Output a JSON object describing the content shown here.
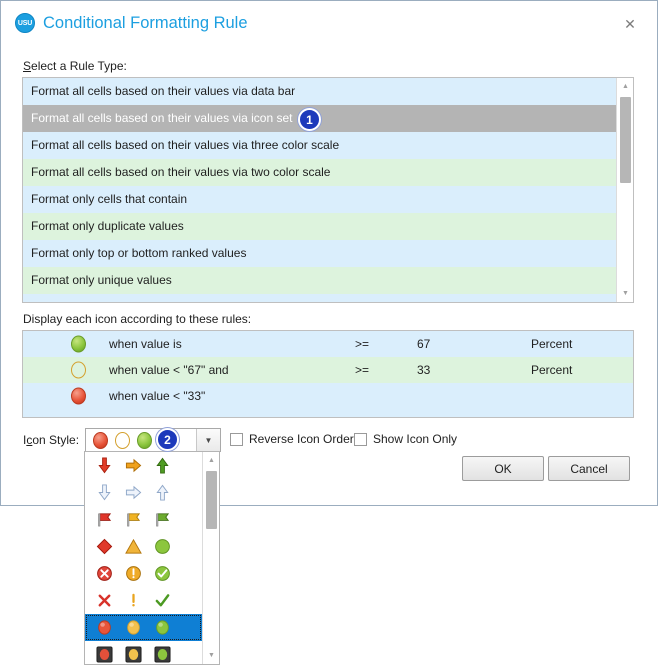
{
  "window": {
    "title": "Conditional Formatting Rule",
    "logo_text": "USU",
    "close_label": "✕"
  },
  "rule_type": {
    "label_prefix": "S",
    "label_rest": "elect a Rule Type:",
    "items": [
      {
        "text": "Format all cells based on their values via data bar",
        "selected": false
      },
      {
        "text": "Format all cells based on their values via icon set",
        "selected": true
      },
      {
        "text": "Format all cells based on their values via three color scale",
        "selected": false
      },
      {
        "text": "Format all cells based on their values via two color scale",
        "selected": false
      },
      {
        "text": "Format only cells that contain",
        "selected": false
      },
      {
        "text": "Format only duplicate values",
        "selected": false
      },
      {
        "text": "Format only top or bottom ranked values",
        "selected": false
      },
      {
        "text": "Format only unique values",
        "selected": false
      }
    ]
  },
  "icon_rules": {
    "label": "Display each icon according to these rules:",
    "rows": [
      {
        "icon": "green-ball-icon",
        "condition": "when value is",
        "operator": ">=",
        "value": "67",
        "value_type": "Percent"
      },
      {
        "icon": "yellow-ball-icon",
        "condition": "when value < \"67\" and",
        "operator": ">=",
        "value": "33",
        "value_type": "Percent"
      },
      {
        "icon": "red-ball-icon",
        "condition": "when value < \"33\"",
        "operator": "",
        "value": "",
        "value_type": ""
      }
    ]
  },
  "icon_style": {
    "label_prefix": "I",
    "label_mn": "c",
    "label_rest": "on Style:",
    "selected_set": "3-traffic-lights-unrimmed",
    "dropdown_arrow": "▼"
  },
  "options": {
    "reverse": {
      "pre": "Reverse Icon Or",
      "mn": "d",
      "post": "er",
      "checked": false
    },
    "show_icon_only": {
      "pre": "Show ",
      "mn": "I",
      "post": "con Only",
      "checked": false
    }
  },
  "buttons": {
    "ok": "OK",
    "cancel": "Cancel"
  },
  "icon_set_options": [
    {
      "name": "3-arrows-colored",
      "icons": [
        "red-down-arrow-icon",
        "orange-right-arrow-icon",
        "green-up-arrow-icon"
      ],
      "selected": false
    },
    {
      "name": "3-arrows-gray",
      "icons": [
        "gray-down-arrow-icon",
        "gray-right-arrow-icon",
        "gray-up-arrow-icon"
      ],
      "selected": false
    },
    {
      "name": "3-flags",
      "icons": [
        "red-flag-icon",
        "yellow-flag-icon",
        "green-flag-icon"
      ],
      "selected": false
    },
    {
      "name": "3-shapes",
      "icons": [
        "red-diamond-icon",
        "yellow-triangle-icon",
        "green-circle-icon"
      ],
      "selected": false
    },
    {
      "name": "3-symbols-circled",
      "icons": [
        "red-cross-circle-icon",
        "yellow-exclamation-circle-icon",
        "green-check-circle-icon"
      ],
      "selected": false
    },
    {
      "name": "3-symbols-uncircled",
      "icons": [
        "red-cross-icon",
        "yellow-exclamation-icon",
        "green-check-icon"
      ],
      "selected": false
    },
    {
      "name": "3-traffic-lights-unrimmed",
      "icons": [
        "red-ball-icon",
        "yellow-ball-icon",
        "green-ball-icon"
      ],
      "selected": true
    },
    {
      "name": "3-traffic-lights-rimmed",
      "icons": [
        "red-ball-boxed-icon",
        "yellow-ball-boxed-icon",
        "green-ball-boxed-icon"
      ],
      "selected": false
    }
  ],
  "markers": [
    {
      "number": "1",
      "target": "rule-type-icon-set-row"
    },
    {
      "number": "2",
      "target": "icon-style-combo"
    }
  ]
}
